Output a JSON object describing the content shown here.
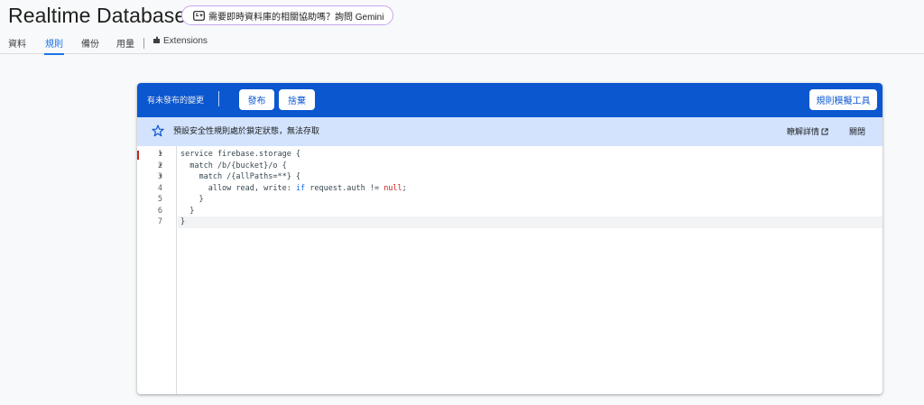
{
  "header": {
    "title": "Realtime Database",
    "gemini_prompt": "需要即時資料庫的相關協助嗎？詢問 Gemini"
  },
  "tabs": [
    {
      "label": "資料",
      "active": false
    },
    {
      "label": "規則",
      "active": true
    },
    {
      "label": "備份",
      "active": false
    },
    {
      "label": "用量",
      "active": false
    },
    {
      "label": "Extensions",
      "active": false
    }
  ],
  "toolbar": {
    "unpublished_label": "有未發布的變更",
    "publish_label": "發布",
    "discard_label": "捨棄",
    "playground_label": "規則模擬工具"
  },
  "banner": {
    "message": "預設安全性規則處於鎖定狀態，無法存取",
    "learn_more_label": "瞭解詳情",
    "close_label": "關閉"
  },
  "editor": {
    "line_numbers": [
      "1",
      "2",
      "3",
      "4",
      "5",
      "6",
      "7"
    ],
    "lines": [
      "service firebase.storage {",
      "  match /b/{bucket}/o {",
      "    match /{allPaths=**} {",
      "      allow read, write: if request.auth != null;",
      "    }",
      "  }",
      "}"
    ],
    "current_line": 7
  },
  "colors": {
    "accent": "#0b57d0",
    "banner_bg": "#d3e3fd",
    "tab_active": "#1a73e8",
    "null_keyword": "#c5221f"
  }
}
